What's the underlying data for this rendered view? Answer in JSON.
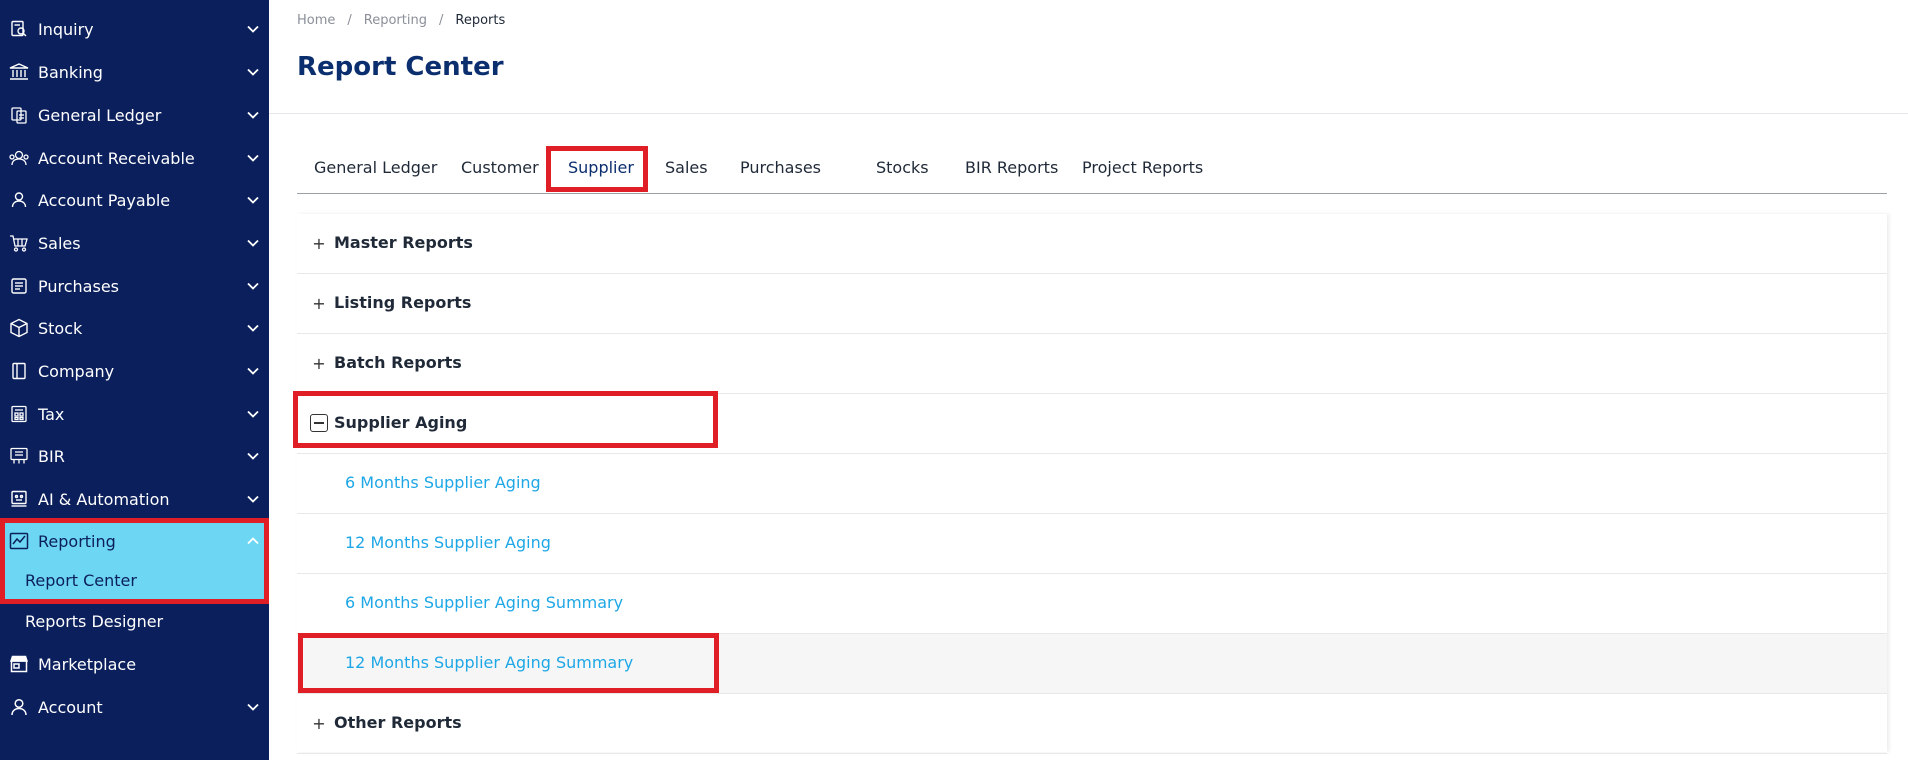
{
  "sidebar": {
    "items": [
      {
        "label": "Inquiry",
        "icon": "inquiry-icon"
      },
      {
        "label": "Banking",
        "icon": "bank-icon"
      },
      {
        "label": "General Ledger",
        "icon": "ledger-icon"
      },
      {
        "label": "Account Receivable",
        "icon": "receivable-icon"
      },
      {
        "label": "Account Payable",
        "icon": "payable-icon"
      },
      {
        "label": "Sales",
        "icon": "cart-icon"
      },
      {
        "label": "Purchases",
        "icon": "purchase-icon"
      },
      {
        "label": "Stock",
        "icon": "box-icon"
      },
      {
        "label": "Company",
        "icon": "company-icon"
      },
      {
        "label": "Tax",
        "icon": "tax-icon"
      },
      {
        "label": "BIR",
        "icon": "bir-icon"
      },
      {
        "label": "AI & Automation",
        "icon": "automation-icon"
      },
      {
        "label": "Reporting",
        "icon": "chart-icon"
      }
    ],
    "sub_items": [
      {
        "label": "Report Center"
      },
      {
        "label": "Reports Designer"
      }
    ],
    "bottom_items": [
      {
        "label": "Marketplace",
        "icon": "store-icon"
      },
      {
        "label": "Account",
        "icon": "user-icon"
      }
    ],
    "active_color": "#6dd6f2",
    "bg_color": "#0b1f5c"
  },
  "breadcrumb": {
    "items": [
      "Home",
      "Reporting",
      "Reports"
    ],
    "separator": "/"
  },
  "page": {
    "title": "Report Center"
  },
  "tabs": {
    "items": [
      "General Ledger",
      "Customer",
      "Supplier",
      "Sales",
      "Purchases",
      "Stocks",
      "BIR Reports",
      "Project Reports"
    ],
    "active": "Supplier"
  },
  "reports": {
    "groups": [
      {
        "label": "Master Reports",
        "expanded": false
      },
      {
        "label": "Listing Reports",
        "expanded": false
      },
      {
        "label": "Batch Reports",
        "expanded": false
      },
      {
        "label": "Supplier Aging",
        "expanded": true,
        "items": [
          "6 Months Supplier Aging",
          "12 Months Supplier Aging",
          "6 Months Supplier Aging Summary",
          "12 Months Supplier Aging Summary"
        ]
      },
      {
        "label": "Other Reports",
        "expanded": false
      }
    ],
    "expand_symbol": "+",
    "link_color": "#1ea7e6"
  },
  "highlight_color": "#e01e26"
}
